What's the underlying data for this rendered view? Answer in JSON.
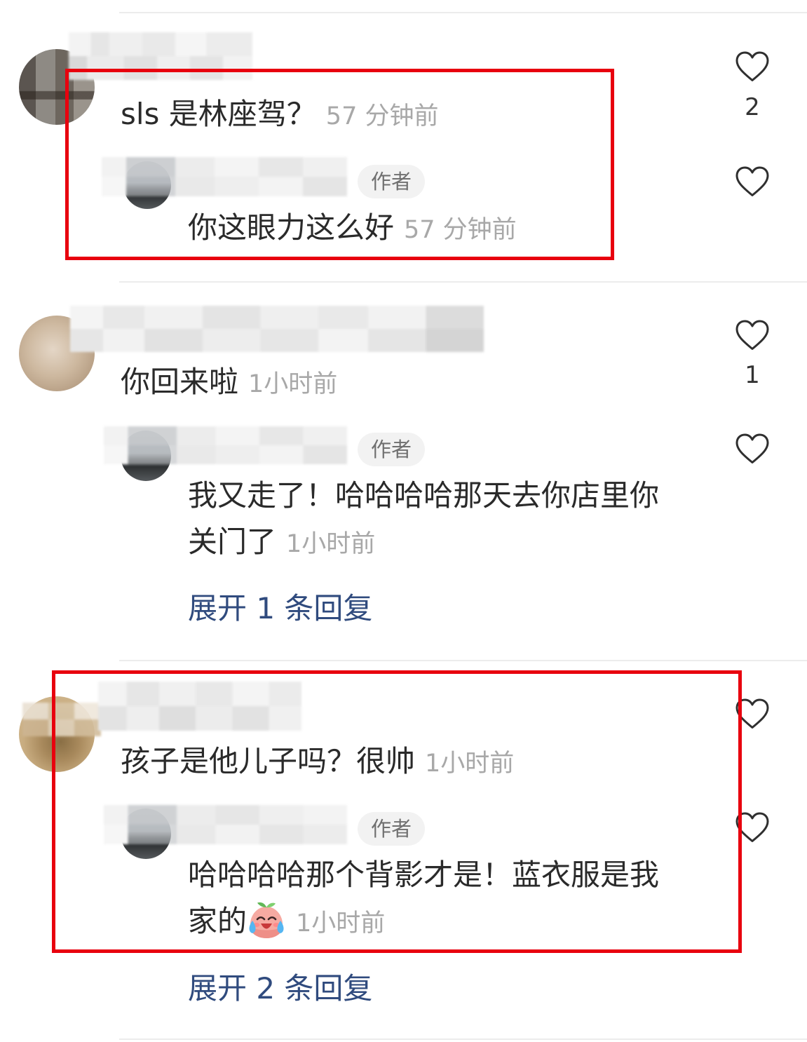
{
  "colors": {
    "highlight_box": "#e8000e",
    "expand_link": "#304b7e",
    "timestamp": "#a8a8a8",
    "text": "#2a2a2a"
  },
  "icons": {
    "like": "heart-outline-icon",
    "reply_emoji": "crying-laughing-emoji"
  },
  "comments": [
    {
      "text": "sls 是林座驾？",
      "time": "57 分钟前",
      "likes": "2",
      "highlighted": true,
      "reply": {
        "badge": "作者",
        "text": "你这眼力这么好",
        "time": "57 分钟前"
      }
    },
    {
      "text": "你回来啦",
      "time": "1小时前",
      "likes": "1",
      "highlighted": false,
      "reply": {
        "badge": "作者",
        "text": "我又走了！哈哈哈哈那天去你店里你关门了",
        "time": "1小时前"
      },
      "expand": "展开 1 条回复"
    },
    {
      "text": "孩子是他儿子吗？很帅",
      "time": "1小时前",
      "highlighted": true,
      "reply": {
        "badge": "作者",
        "text": "哈哈哈哈那个背影才是！蓝衣服是我家的",
        "emoji": "crying-laughing-emoji",
        "time": "1小时前"
      },
      "expand": "展开 2 条回复"
    }
  ]
}
